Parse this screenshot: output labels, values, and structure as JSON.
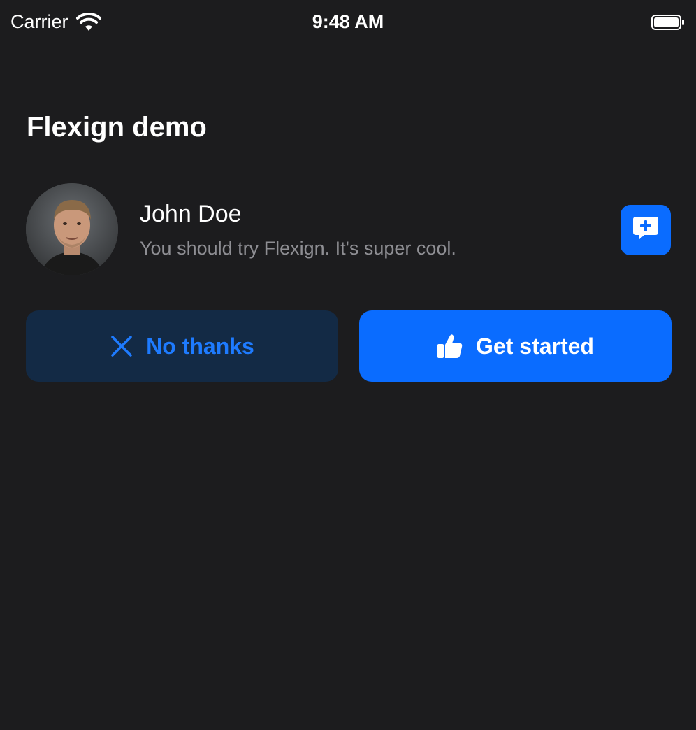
{
  "status_bar": {
    "carrier": "Carrier",
    "time": "9:48 AM"
  },
  "header": {
    "title": "Flexign demo"
  },
  "profile": {
    "name": "John Doe",
    "message": "You should try Flexign. It's super cool."
  },
  "actions": {
    "secondary_label": "No thanks",
    "primary_label": "Get started"
  },
  "icons": {
    "wifi": "wifi-icon",
    "battery": "battery-icon",
    "comment": "comment-plus-icon",
    "close": "close-icon",
    "thumbs_up": "thumbs-up-icon"
  },
  "colors": {
    "background": "#1c1c1e",
    "accent": "#0a6cff",
    "secondary_button_bg": "#132a45",
    "secondary_text": "#8e8e93"
  }
}
